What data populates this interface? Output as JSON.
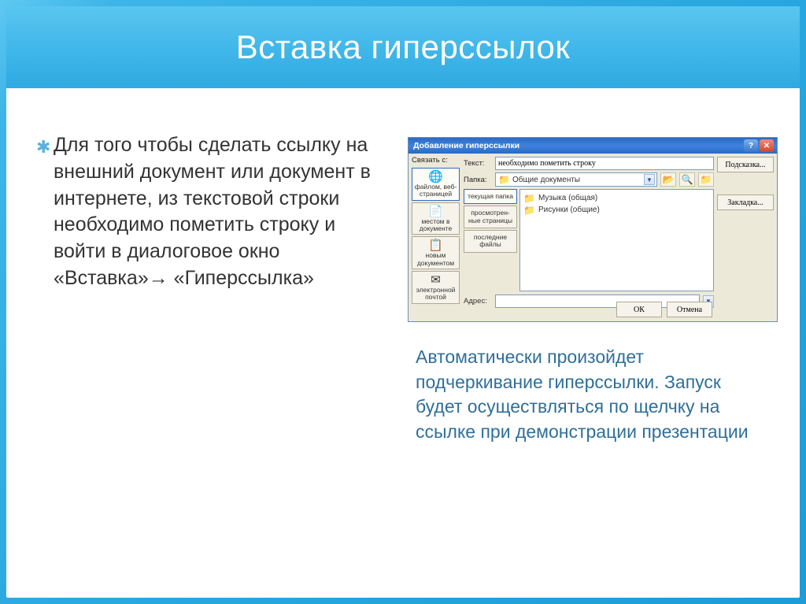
{
  "slide": {
    "title": "Вставка гиперссылок",
    "body_left": "Для того чтобы сделать ссылку на внешний документ или документ в интернете,  из текстовой строки необходимо пометить строку   и войти в диалоговое окно «Вставка»→ «Гиперссылка»",
    "body_right": "Автоматически произойдет подчеркивание гиперссылки. Запуск будет осуществляться по щелчку на ссылке при демонстрации презентации"
  },
  "dialog": {
    "title": "Добавление гиперссылки",
    "link_with_label": "Связать с:",
    "places": [
      {
        "icon": "🌐",
        "label": "файлом, веб-страницей"
      },
      {
        "icon": "📄",
        "label": "местом в документе"
      },
      {
        "icon": "📋",
        "label": "новым документом"
      },
      {
        "icon": "✉",
        "label": "электронной почтой"
      }
    ],
    "text_label": "Текст:",
    "text_value": "необходимо пометить строку",
    "folder_label": "Папка:",
    "folder_value": "Общие документы",
    "browse_tabs": [
      {
        "label": "текущая папка"
      },
      {
        "label": "просмотрен-\nные страницы"
      },
      {
        "label": "последние файлы"
      }
    ],
    "files": [
      {
        "label": "Музыка (общая)"
      },
      {
        "label": "Рисунки (общие)"
      }
    ],
    "address_label": "Адрес:",
    "address_value": "",
    "btn_hint": "Подсказка...",
    "btn_bookmark": "Закладка...",
    "btn_ok": "ОК",
    "btn_cancel": "Отмена"
  }
}
